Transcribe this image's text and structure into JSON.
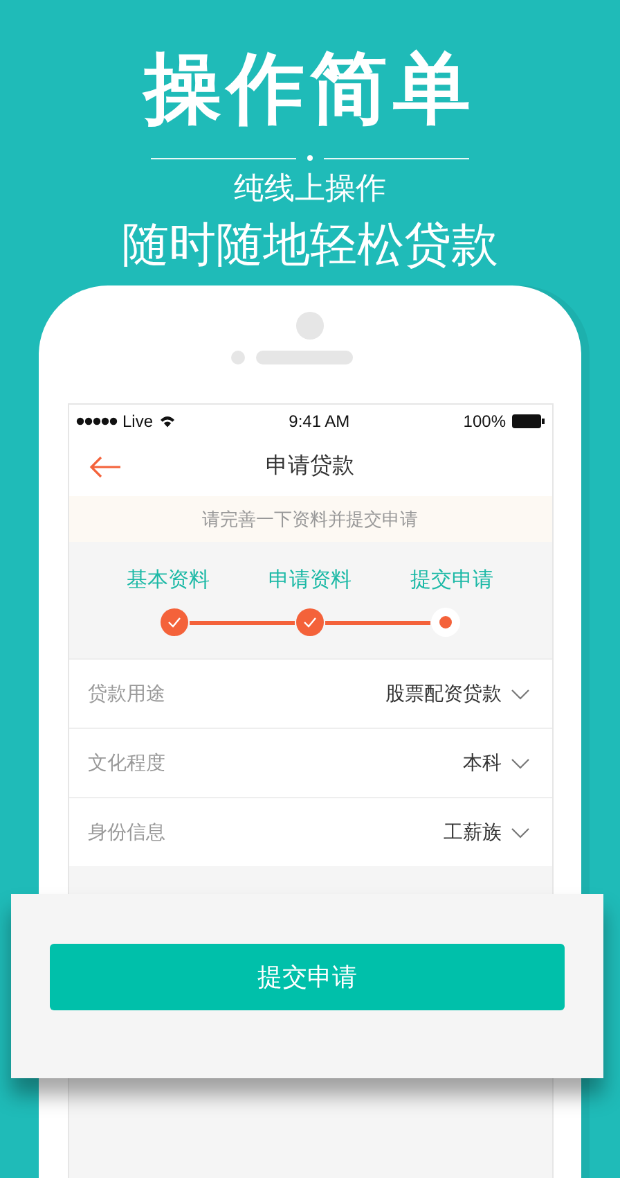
{
  "headline": "操作简单",
  "subtitle": "纯线上操作",
  "tagline": "随时随地轻松贷款",
  "status_bar": {
    "carrier": "Live",
    "time": "9:41 AM",
    "battery": "100%"
  },
  "nav": {
    "title": "申请贷款"
  },
  "notice": "请完善一下资料并提交申请",
  "steps": [
    {
      "label": "基本资料",
      "completed": true
    },
    {
      "label": "申请资料",
      "completed": true
    },
    {
      "label": "提交申请",
      "completed": false
    }
  ],
  "fields": [
    {
      "label": "贷款用途",
      "value": "股票配资贷款"
    },
    {
      "label": "文化程度",
      "value": "本科"
    },
    {
      "label": "身份信息",
      "value": "工薪族"
    }
  ],
  "submit_button": "提交申请"
}
